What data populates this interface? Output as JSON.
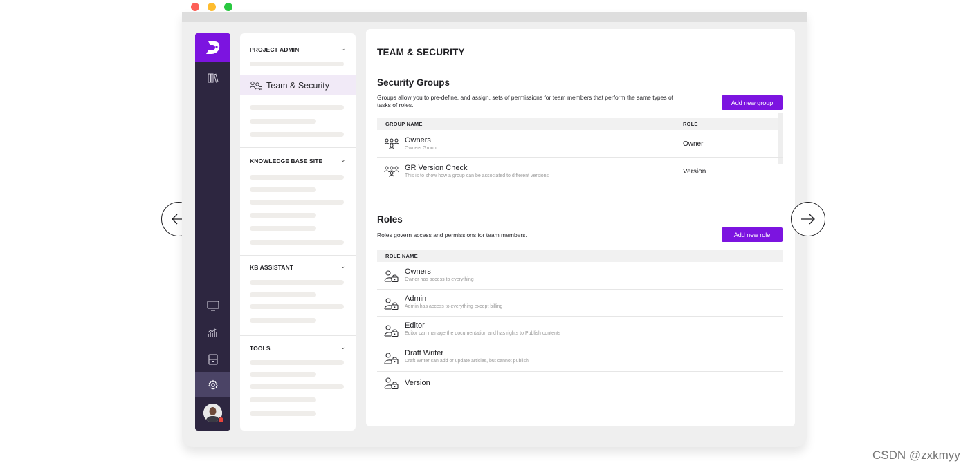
{
  "colors": {
    "accent": "#7c14e0",
    "rail": "#2d2640",
    "rail_active": "#4b4466",
    "nav_active": "#f1eaf7",
    "traffic_red": "#fd5f57",
    "traffic_yellow": "#febc2e",
    "traffic_green": "#29c840"
  },
  "rail": {
    "icons": [
      "books-icon",
      "monitor-icon",
      "analytics-icon",
      "archive-icon",
      "gear-icon"
    ],
    "active": "gear-icon"
  },
  "nav": {
    "sections": [
      {
        "title": "PROJECT ADMIN",
        "expanded": true
      },
      {
        "title": "KNOWLEDGE BASE SITE",
        "expanded": true
      },
      {
        "title": "KB ASSISTANT",
        "expanded": true
      },
      {
        "title": "TOOLS",
        "expanded": true
      }
    ],
    "active_item": "Team & Security"
  },
  "main": {
    "title": "TEAM & SECURITY",
    "security_groups": {
      "title": "Security Groups",
      "description": "Groups allow you to pre-define, and assign, sets of permissions for team members that perform the same types of tasks of roles.",
      "add_button": "Add new group",
      "columns": [
        "GROUP NAME",
        "ROLE"
      ],
      "rows": [
        {
          "name": "Owners",
          "sub": "Owners Group",
          "role": "Owner"
        },
        {
          "name": "GR Version Check",
          "sub": "This is to show how a group can be associated to different versions",
          "role": "Version"
        }
      ]
    },
    "roles": {
      "title": "Roles",
      "description": "Roles govern access and permissions for team members.",
      "add_button": "Add new role",
      "columns": [
        "ROLE NAME"
      ],
      "rows": [
        {
          "name": "Owners",
          "sub": "Owner has access to everything"
        },
        {
          "name": "Admin",
          "sub": "Admin has access to everything except billing"
        },
        {
          "name": "Editor",
          "sub": "Editor can manage the documentation and has rights to Publish contents"
        },
        {
          "name": "Draft Writer",
          "sub": "Draft Writer can add or update articles, but cannot publish"
        },
        {
          "name": "Version",
          "sub": ""
        }
      ]
    }
  },
  "carousel": {
    "prev": "arrow-left-icon",
    "next": "arrow-right-icon"
  },
  "watermark": "CSDN @zxkmyy"
}
